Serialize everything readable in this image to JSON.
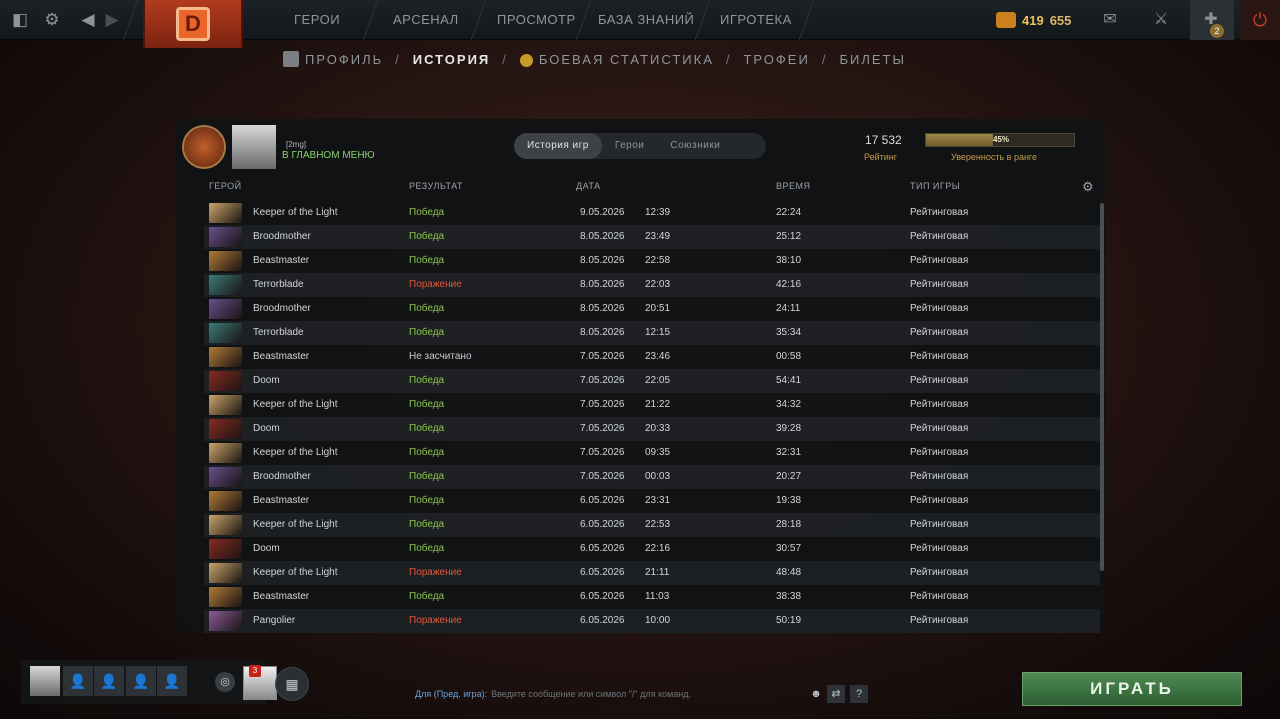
{
  "topbar": {
    "nav": [
      "ГЕРОИ",
      "АРСЕНАЛ",
      "ПРОСМОТР",
      "БАЗА ЗНАНИЙ",
      "ИГРОТЕКА"
    ],
    "currency1": "419",
    "currency2": "655",
    "shard_badge": "2"
  },
  "subnav": {
    "items": [
      "ПРОФИЛЬ",
      "ИСТОРИЯ",
      "БОЕВАЯ СТАТИСТИКА",
      "ТРОФЕИ",
      "БИЛЕТЫ"
    ],
    "separator": "/"
  },
  "profile": {
    "tag": "[2mg]",
    "status": "В ГЛАВНОМ МЕНЮ"
  },
  "tabs": [
    "История игр",
    "Герои",
    "Союзники"
  ],
  "rating": {
    "value": "17 532",
    "label": "Рейтинг",
    "confidence_pct": "45%",
    "confidence_value": 45,
    "confidence_label": "Уверенность в ранге"
  },
  "columns": {
    "hero": "ГЕРОЙ",
    "result": "РЕЗУЛЬТАТ",
    "date": "ДАТА",
    "duration": "ВРЕМЯ",
    "type": "ТИП ИГРЫ"
  },
  "matches": [
    {
      "hero": "Keeper of the Light",
      "result": "Победа",
      "status": "win",
      "date": "9.05.2026",
      "time": "12:39",
      "duration": "22:24",
      "type": "Рейтинговая",
      "color": "#c9a56a"
    },
    {
      "hero": "Broodmother",
      "result": "Победа",
      "status": "win",
      "date": "8.05.2026",
      "time": "23:49",
      "duration": "25:12",
      "type": "Рейтинговая",
      "color": "#6a4e8c"
    },
    {
      "hero": "Beastmaster",
      "result": "Победа",
      "status": "win",
      "date": "8.05.2026",
      "time": "22:58",
      "duration": "38:10",
      "type": "Рейтинговая",
      "color": "#b07a3a"
    },
    {
      "hero": "Terrorblade",
      "result": "Поражение",
      "status": "loss",
      "date": "8.05.2026",
      "time": "22:03",
      "duration": "42:16",
      "type": "Рейтинговая",
      "color": "#3a7a7a"
    },
    {
      "hero": "Broodmother",
      "result": "Победа",
      "status": "win",
      "date": "8.05.2026",
      "time": "20:51",
      "duration": "24:11",
      "type": "Рейтинговая",
      "color": "#6a4e8c"
    },
    {
      "hero": "Terrorblade",
      "result": "Победа",
      "status": "win",
      "date": "8.05.2026",
      "time": "12:15",
      "duration": "35:34",
      "type": "Рейтинговая",
      "color": "#3a7a7a"
    },
    {
      "hero": "Beastmaster",
      "result": "Не засчитано",
      "status": "na",
      "date": "7.05.2026",
      "time": "23:46",
      "duration": "00:58",
      "type": "Рейтинговая",
      "color": "#b07a3a"
    },
    {
      "hero": "Doom",
      "result": "Победа",
      "status": "win",
      "date": "7.05.2026",
      "time": "22:05",
      "duration": "54:41",
      "type": "Рейтинговая",
      "color": "#8a2a22"
    },
    {
      "hero": "Keeper of the Light",
      "result": "Победа",
      "status": "win",
      "date": "7.05.2026",
      "time": "21:22",
      "duration": "34:32",
      "type": "Рейтинговая",
      "color": "#c9a56a"
    },
    {
      "hero": "Doom",
      "result": "Победа",
      "status": "win",
      "date": "7.05.2026",
      "time": "20:33",
      "duration": "39:28",
      "type": "Рейтинговая",
      "color": "#8a2a22"
    },
    {
      "hero": "Keeper of the Light",
      "result": "Победа",
      "status": "win",
      "date": "7.05.2026",
      "time": "09:35",
      "duration": "32:31",
      "type": "Рейтинговая",
      "color": "#c9a56a"
    },
    {
      "hero": "Broodmother",
      "result": "Победа",
      "status": "win",
      "date": "7.05.2026",
      "time": "00:03",
      "duration": "20:27",
      "type": "Рейтинговая",
      "color": "#6a4e8c"
    },
    {
      "hero": "Beastmaster",
      "result": "Победа",
      "status": "win",
      "date": "6.05.2026",
      "time": "23:31",
      "duration": "19:38",
      "type": "Рейтинговая",
      "color": "#b07a3a"
    },
    {
      "hero": "Keeper of the Light",
      "result": "Победа",
      "status": "win",
      "date": "6.05.2026",
      "time": "22:53",
      "duration": "28:18",
      "type": "Рейтинговая",
      "color": "#c9a56a"
    },
    {
      "hero": "Doom",
      "result": "Победа",
      "status": "win",
      "date": "6.05.2026",
      "time": "22:16",
      "duration": "30:57",
      "type": "Рейтинговая",
      "color": "#8a2a22"
    },
    {
      "hero": "Keeper of the Light",
      "result": "Поражение",
      "status": "loss",
      "date": "6.05.2026",
      "time": "21:11",
      "duration": "48:48",
      "type": "Рейтинговая",
      "color": "#c9a56a"
    },
    {
      "hero": "Beastmaster",
      "result": "Победа",
      "status": "win",
      "date": "6.05.2026",
      "time": "11:03",
      "duration": "38:38",
      "type": "Рейтинговая",
      "color": "#b07a3a"
    },
    {
      "hero": "Pangolier",
      "result": "Поражение",
      "status": "loss",
      "date": "6.05.2026",
      "time": "10:00",
      "duration": "50:19",
      "type": "Рейтинговая",
      "color": "#8a5a9a"
    }
  ],
  "party": {
    "badge": "3"
  },
  "chat": {
    "channel": "Для (Пред. игра):",
    "placeholder": "Введите сообщение или символ \"/\" для команд."
  },
  "play_button": "ИГРАТЬ",
  "icons": {
    "dota-logo": "dota-logo",
    "settings": "gear-icon",
    "back": "back-arrow-icon",
    "mail": "mail-icon",
    "armory": "armory-icon",
    "shards": "shards-icon",
    "power": "power-icon"
  }
}
